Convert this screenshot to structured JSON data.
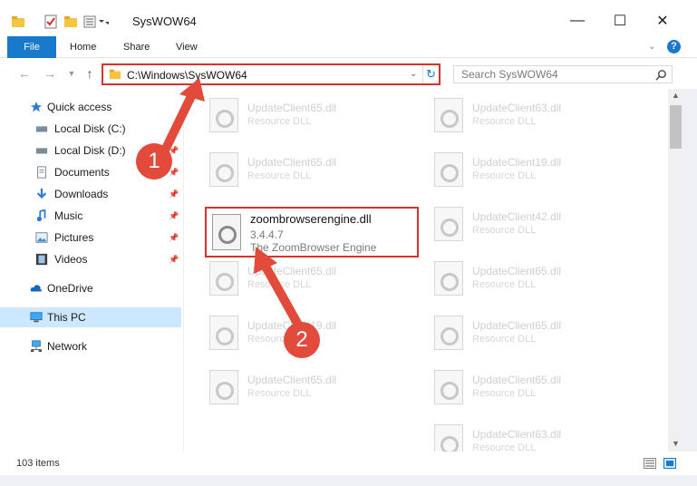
{
  "window": {
    "title": "SysWOW64",
    "minimize_icon": "minimize-icon",
    "maximize_icon": "maximize-icon",
    "close_icon": "close-icon"
  },
  "ribbon": {
    "tabs": [
      "File",
      "Home",
      "Share",
      "View"
    ],
    "help": "?"
  },
  "nav": {
    "address": "C:\\Windows\\SysWOW64",
    "search_placeholder": "Search SysWOW64"
  },
  "sidebar": {
    "items": [
      {
        "label": "Quick access",
        "icon": "star-icon"
      },
      {
        "label": "Local Disk (C:)",
        "icon": "drive-icon"
      },
      {
        "label": "Local Disk (D:)",
        "icon": "drive-icon"
      },
      {
        "label": "Documents",
        "icon": "documents-icon"
      },
      {
        "label": "Downloads",
        "icon": "download-icon"
      },
      {
        "label": "Music",
        "icon": "music-icon"
      },
      {
        "label": "Pictures",
        "icon": "pictures-icon"
      },
      {
        "label": "Videos",
        "icon": "videos-icon"
      },
      {
        "label": "OneDrive",
        "icon": "cloud-icon"
      },
      {
        "label": "This PC",
        "icon": "pc-icon"
      },
      {
        "label": "Network",
        "icon": "network-icon"
      }
    ]
  },
  "files": {
    "left": [
      {
        "name": "UpdateClient65.dll",
        "desc": "Resource DLL"
      },
      {
        "name": "UpdateClient65.dll",
        "desc": "Resource DLL"
      },
      {
        "name": "UpdateClient65.dll",
        "desc": "Resource DLL"
      },
      {
        "name": "UpdateClient19.dll",
        "desc": "Resource DLL"
      },
      {
        "name": "UpdateClient65.dll",
        "desc": "Resource DLL"
      }
    ],
    "right": [
      {
        "name": "UpdateClient63.dll",
        "desc": "Resource DLL"
      },
      {
        "name": "UpdateClient19.dll",
        "desc": "Resource DLL"
      },
      {
        "name": "UpdateClient42.dll",
        "desc": "Resource DLL"
      },
      {
        "name": "UpdateClient65.dll",
        "desc": "Resource DLL"
      },
      {
        "name": "UpdateClient65.dll",
        "desc": "Resource DLL"
      },
      {
        "name": "UpdateClient65.dll",
        "desc": "Resource DLL"
      },
      {
        "name": "UpdateClient63.dll",
        "desc": "Resource DLL"
      }
    ],
    "highlighted": {
      "name": "zoombrowserengine.dll",
      "version": "3.4.4.7",
      "desc": "The ZoomBrowser Engine"
    }
  },
  "status": {
    "count": "103 items"
  },
  "annotations": {
    "step1": "1",
    "step2": "2",
    "color": "#e24a3b"
  }
}
